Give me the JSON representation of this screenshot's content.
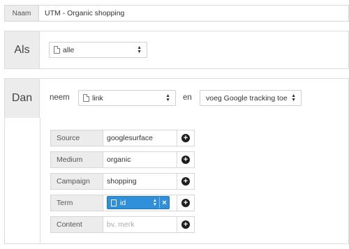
{
  "naam": {
    "label": "Naam",
    "value": "UTM - Organic shopping"
  },
  "als": {
    "label": "Als",
    "select_value": "alle"
  },
  "dan": {
    "label": "Dan",
    "take_word": "neem",
    "take_select": "link",
    "and_word": "en",
    "action_select": "voeg Google tracking toe"
  },
  "params": [
    {
      "label": "Source",
      "value": "googlesurface"
    },
    {
      "label": "Medium",
      "value": "organic"
    },
    {
      "label": "Campaign",
      "value": "shopping"
    },
    {
      "label": "Term",
      "token": "id"
    },
    {
      "label": "Content",
      "placeholder": "bv. merk"
    }
  ],
  "icons": {
    "doc": "document-icon",
    "add": "plus-circle-icon",
    "remove": "close-icon",
    "select": "select-arrows-icon"
  },
  "colors": {
    "token_bg": "#2f8fd8",
    "label_bg": "#ececec"
  }
}
